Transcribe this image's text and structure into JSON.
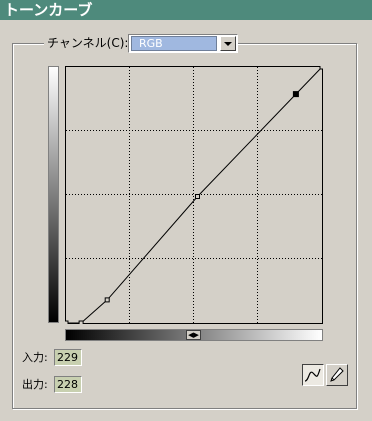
{
  "window": {
    "title": "トーンカーブ"
  },
  "channel": {
    "label": "チャンネル(C):",
    "selected": "RGB"
  },
  "curve": {
    "control_points": [
      {
        "in": 0,
        "out": 0
      },
      {
        "in": 15,
        "out": 0
      },
      {
        "in": 41,
        "out": 23
      },
      {
        "in": 131,
        "out": 126
      },
      {
        "in": 229,
        "out": 228
      },
      {
        "in": 255,
        "out": 255
      }
    ],
    "selected_index": 4
  },
  "input": {
    "label": "入力:",
    "value": "229"
  },
  "output": {
    "label": "出力:",
    "value": "228"
  },
  "tools": {
    "curve_mode": "curve-tool-icon",
    "pencil_mode": "pencil-icon"
  },
  "colors": {
    "title_bar": "#4e8a7c",
    "dialog_bg": "#d4d0c8",
    "selection": "#a0b8e0"
  }
}
